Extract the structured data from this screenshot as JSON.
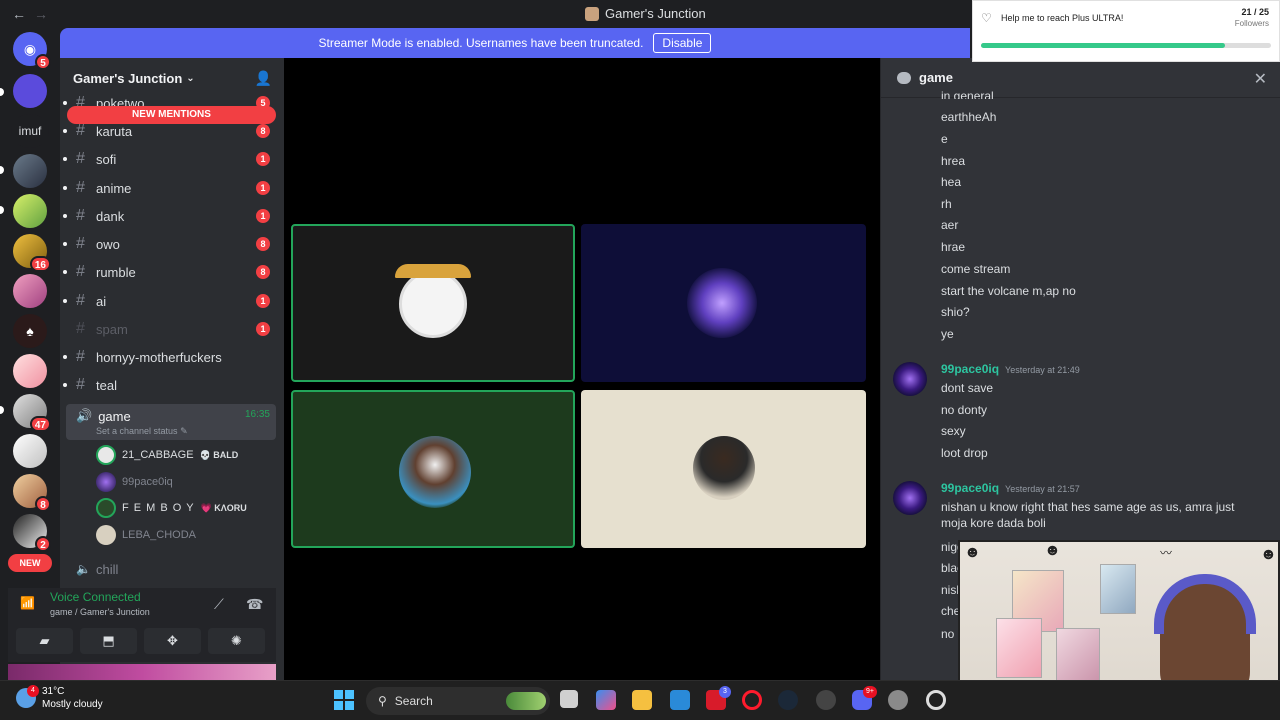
{
  "titlebar": {
    "back": "←",
    "forward": "→",
    "title": "Gamer's Junction"
  },
  "banner": {
    "text": "Streamer Mode is enabled. Usernames have been truncated.",
    "button": "Disable"
  },
  "rail": {
    "home_badge": "5",
    "imuf_label": "imuf",
    "badges": [
      "16",
      "47",
      "8",
      "2"
    ],
    "new_label": "NEW"
  },
  "sidebar": {
    "server_name": "Gamer's Junction",
    "new_mentions": "NEW MENTIONS",
    "channels": [
      {
        "name": "poketwo",
        "count": "5"
      },
      {
        "name": "karuta",
        "count": "8"
      },
      {
        "name": "sofi",
        "count": "1"
      },
      {
        "name": "anime",
        "count": "1"
      },
      {
        "name": "dank",
        "count": "1"
      },
      {
        "name": "owo",
        "count": "8"
      },
      {
        "name": "rumble",
        "count": "8"
      },
      {
        "name": "ai",
        "count": "1"
      },
      {
        "name": "spam",
        "count": "1"
      },
      {
        "name": "hornyy-motherfuckers",
        "count": ""
      },
      {
        "name": "teal",
        "count": ""
      }
    ],
    "voice_channel": {
      "name": "game",
      "time": "16:35",
      "status": "Set a channel status"
    },
    "voice_users": [
      {
        "name": "21_CABBAGE",
        "tag": "BALD"
      },
      {
        "name": "99pace0iq",
        "tag": ""
      },
      {
        "name": "F E M B O Y",
        "tag": "KΛORU"
      },
      {
        "name": "LEBA_CHODA",
        "tag": ""
      }
    ],
    "chill": "chill"
  },
  "voice_panel": {
    "status": "Voice Connected",
    "location": "game / Gamer's Junction"
  },
  "chat": {
    "channel": "game",
    "top_messages": [
      "in general",
      "earthheAh",
      "e",
      "hrea",
      "hea",
      "rh",
      "aer",
      "hrae",
      "come stream",
      "start the volcane m,ap no",
      "shio?",
      "ye"
    ],
    "groups": [
      {
        "author": "99pace0iq",
        "time": "Yesterday at 21:49",
        "lines": [
          "dont save",
          "no donty",
          "sexy",
          "loot  drop"
        ]
      },
      {
        "author": "99pace0iq",
        "time": "Yesterday at 21:57",
        "lines": [
          "nishan u  know right that hes same age as us, amra just moja kore dada boli",
          "nigg",
          "blac",
          "nish",
          "che",
          "no"
        ]
      }
    ]
  },
  "notification": {
    "text": "Help me to reach Plus ULTRA!",
    "count": "21 / 25",
    "label": "Followers",
    "progress": 0.84
  },
  "taskbar": {
    "temp": "31°C",
    "weather": "Mostly cloudy",
    "weather_badge": "4",
    "search": "Search",
    "app_badges": [
      "3",
      "9+"
    ]
  },
  "colors": {
    "accent": "#5865f2",
    "online": "#23a55a",
    "mention": "#f23f43",
    "author": "#2dc5a0"
  }
}
